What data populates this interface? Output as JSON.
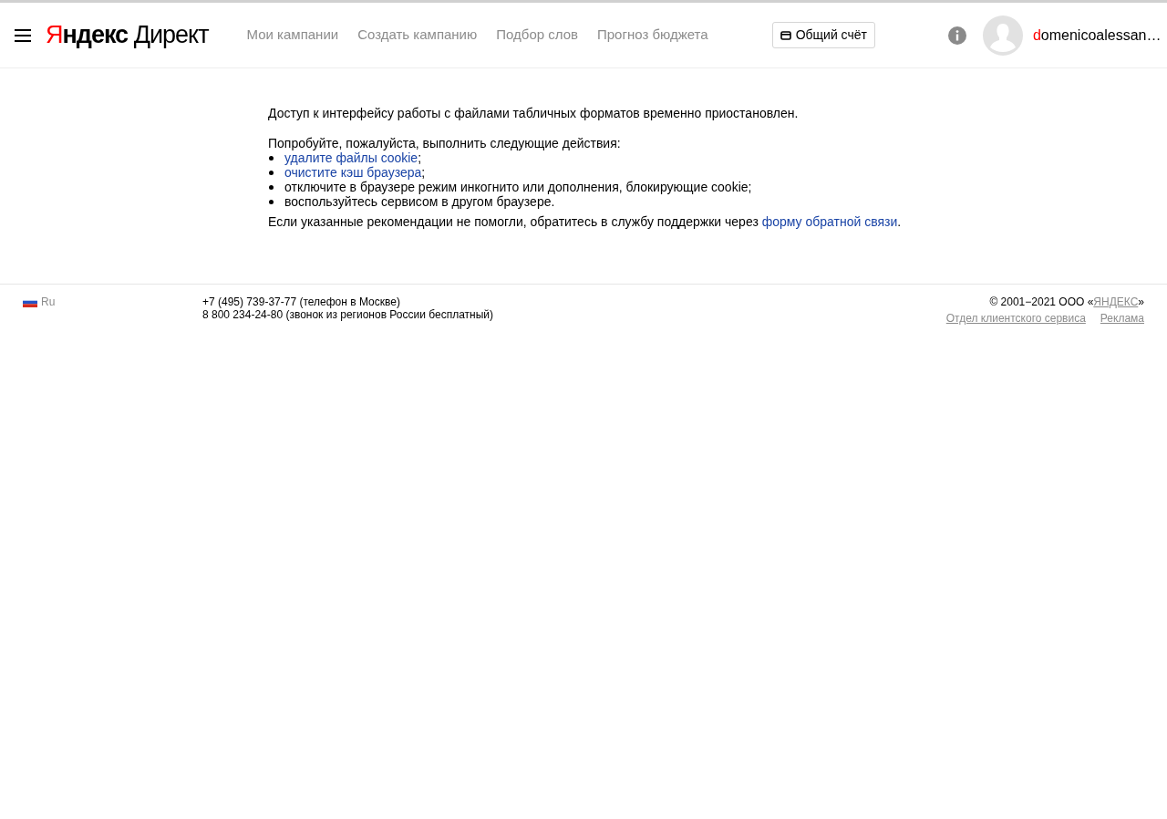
{
  "header": {
    "logo": {
      "accent": "Я",
      "rest": "ндекс",
      "product": "Директ"
    },
    "nav": [
      {
        "label": "Мои кампании"
      },
      {
        "label": "Создать кампанию"
      },
      {
        "label": "Подбор слов"
      },
      {
        "label": "Прогноз бюджета"
      }
    ],
    "account_button": "Общий счёт",
    "user": {
      "first_letter": "d",
      "rest": "omenicoalessan…"
    }
  },
  "message": {
    "title": "Доступ к интерфейсу работы с файлами табличных форматов временно приостановлен.",
    "intro": "Попробуйте, пожалуйста, выполнить следующие действия:",
    "steps": [
      {
        "kind": "link",
        "text": "удалите файлы cookie",
        "suffix": ";"
      },
      {
        "kind": "link",
        "text": "очистите кэш браузера",
        "suffix": ";"
      },
      {
        "kind": "text",
        "text": "отключите в браузере режим инкогнито или дополнения, блокирующие cookie;"
      },
      {
        "kind": "text",
        "text": "воспользуйтесь сервисом в другом браузере."
      }
    ],
    "outro": {
      "text": "Если указанные рекомендации не помогли, обратитесь в службу поддержки через",
      "link": "форму обратной связи",
      "suffix": "."
    }
  },
  "footer": {
    "language": "Ru",
    "phones": [
      "+7 (495) 739-37-77 (телефон в Москве)",
      "8 800 234-24-80 (звонок из регионов России бесплатный)"
    ],
    "copyright": {
      "before": "© 2001−2021 ООО «",
      "link": "ЯНДЕКС",
      "after": "»"
    },
    "links": [
      "Отдел клиентского сервиса",
      "Реклама"
    ]
  }
}
